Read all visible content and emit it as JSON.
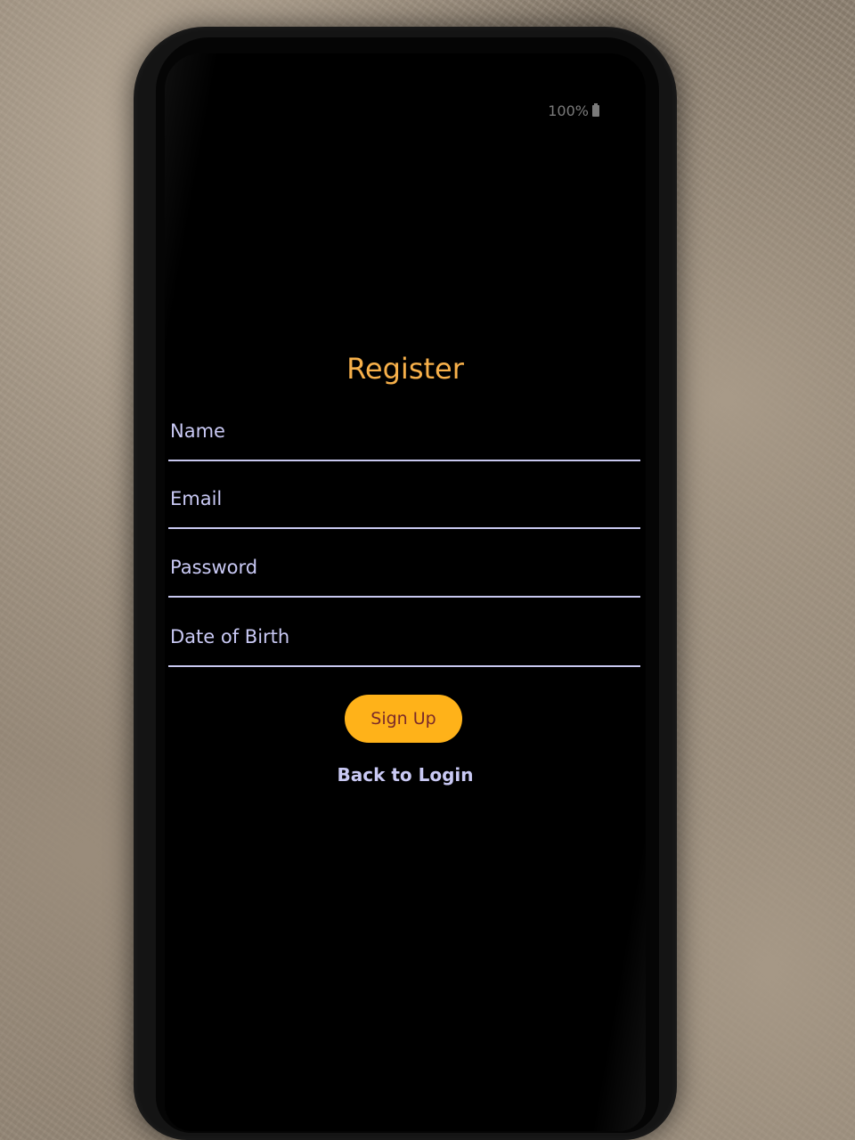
{
  "status_bar": {
    "battery": "100%",
    "battery_icon": "battery-full-icon"
  },
  "register": {
    "title": "Register",
    "fields": [
      {
        "label": "Name"
      },
      {
        "label": "Email"
      },
      {
        "label": "Password"
      },
      {
        "label": "Date of Birth"
      }
    ],
    "signup_label": "Sign Up",
    "back_label": "Back to Login"
  },
  "colors": {
    "title": "#f7b04a",
    "accent_button": "#ffb219",
    "button_text": "#7a2a2a",
    "field_text": "#c9c9f4",
    "background": "#000000"
  }
}
